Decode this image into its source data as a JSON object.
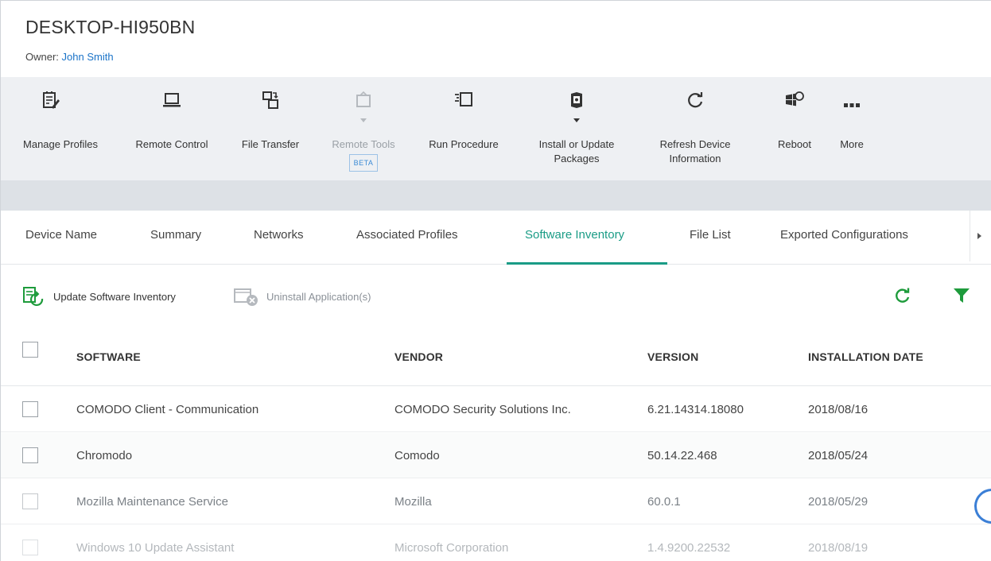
{
  "header": {
    "device_name": "DESKTOP-HI950BN",
    "owner_label": "Owner:",
    "owner_name": "John Smith"
  },
  "toolbar": {
    "manage_profiles": "Manage Profiles",
    "remote_control": "Remote Control",
    "file_transfer": "File Transfer",
    "remote_tools": "Remote Tools",
    "remote_tools_badge": "BETA",
    "run_procedure": "Run Procedure",
    "install_update_line1": "Install or Update",
    "install_update_line2": "Packages",
    "refresh_line1": "Refresh Device",
    "refresh_line2": "Information",
    "reboot": "Reboot",
    "more": "More"
  },
  "tabs": [
    {
      "label": "Device Name"
    },
    {
      "label": "Summary"
    },
    {
      "label": "Networks"
    },
    {
      "label": "Associated Profiles"
    },
    {
      "label": "Software Inventory",
      "active": true
    },
    {
      "label": "File List"
    },
    {
      "label": "Exported Configurations"
    }
  ],
  "actions": {
    "update_inventory": "Update Software Inventory",
    "uninstall": "Uninstall Application(s)"
  },
  "table": {
    "columns": [
      "SOFTWARE",
      "VENDOR",
      "VERSION",
      "INSTALLATION DATE"
    ],
    "rows": [
      {
        "software": "COMODO Client - Communication",
        "vendor": "COMODO Security Solutions Inc.",
        "version": "6.21.14314.18080",
        "date": "2018/08/16"
      },
      {
        "software": "Chromodo",
        "vendor": "Comodo",
        "version": "50.14.22.468",
        "date": "2018/05/24"
      },
      {
        "software": "Mozilla Maintenance Service",
        "vendor": "Mozilla",
        "version": "60.0.1",
        "date": "2018/05/29"
      },
      {
        "software": "Windows 10 Update Assistant",
        "vendor": "Microsoft Corporation",
        "version": "1.4.9200.22532",
        "date": "2018/08/19"
      }
    ]
  },
  "colors": {
    "accent": "#1a9c86",
    "link": "#1a73c8",
    "toolbar_bg": "#eef0f3"
  }
}
